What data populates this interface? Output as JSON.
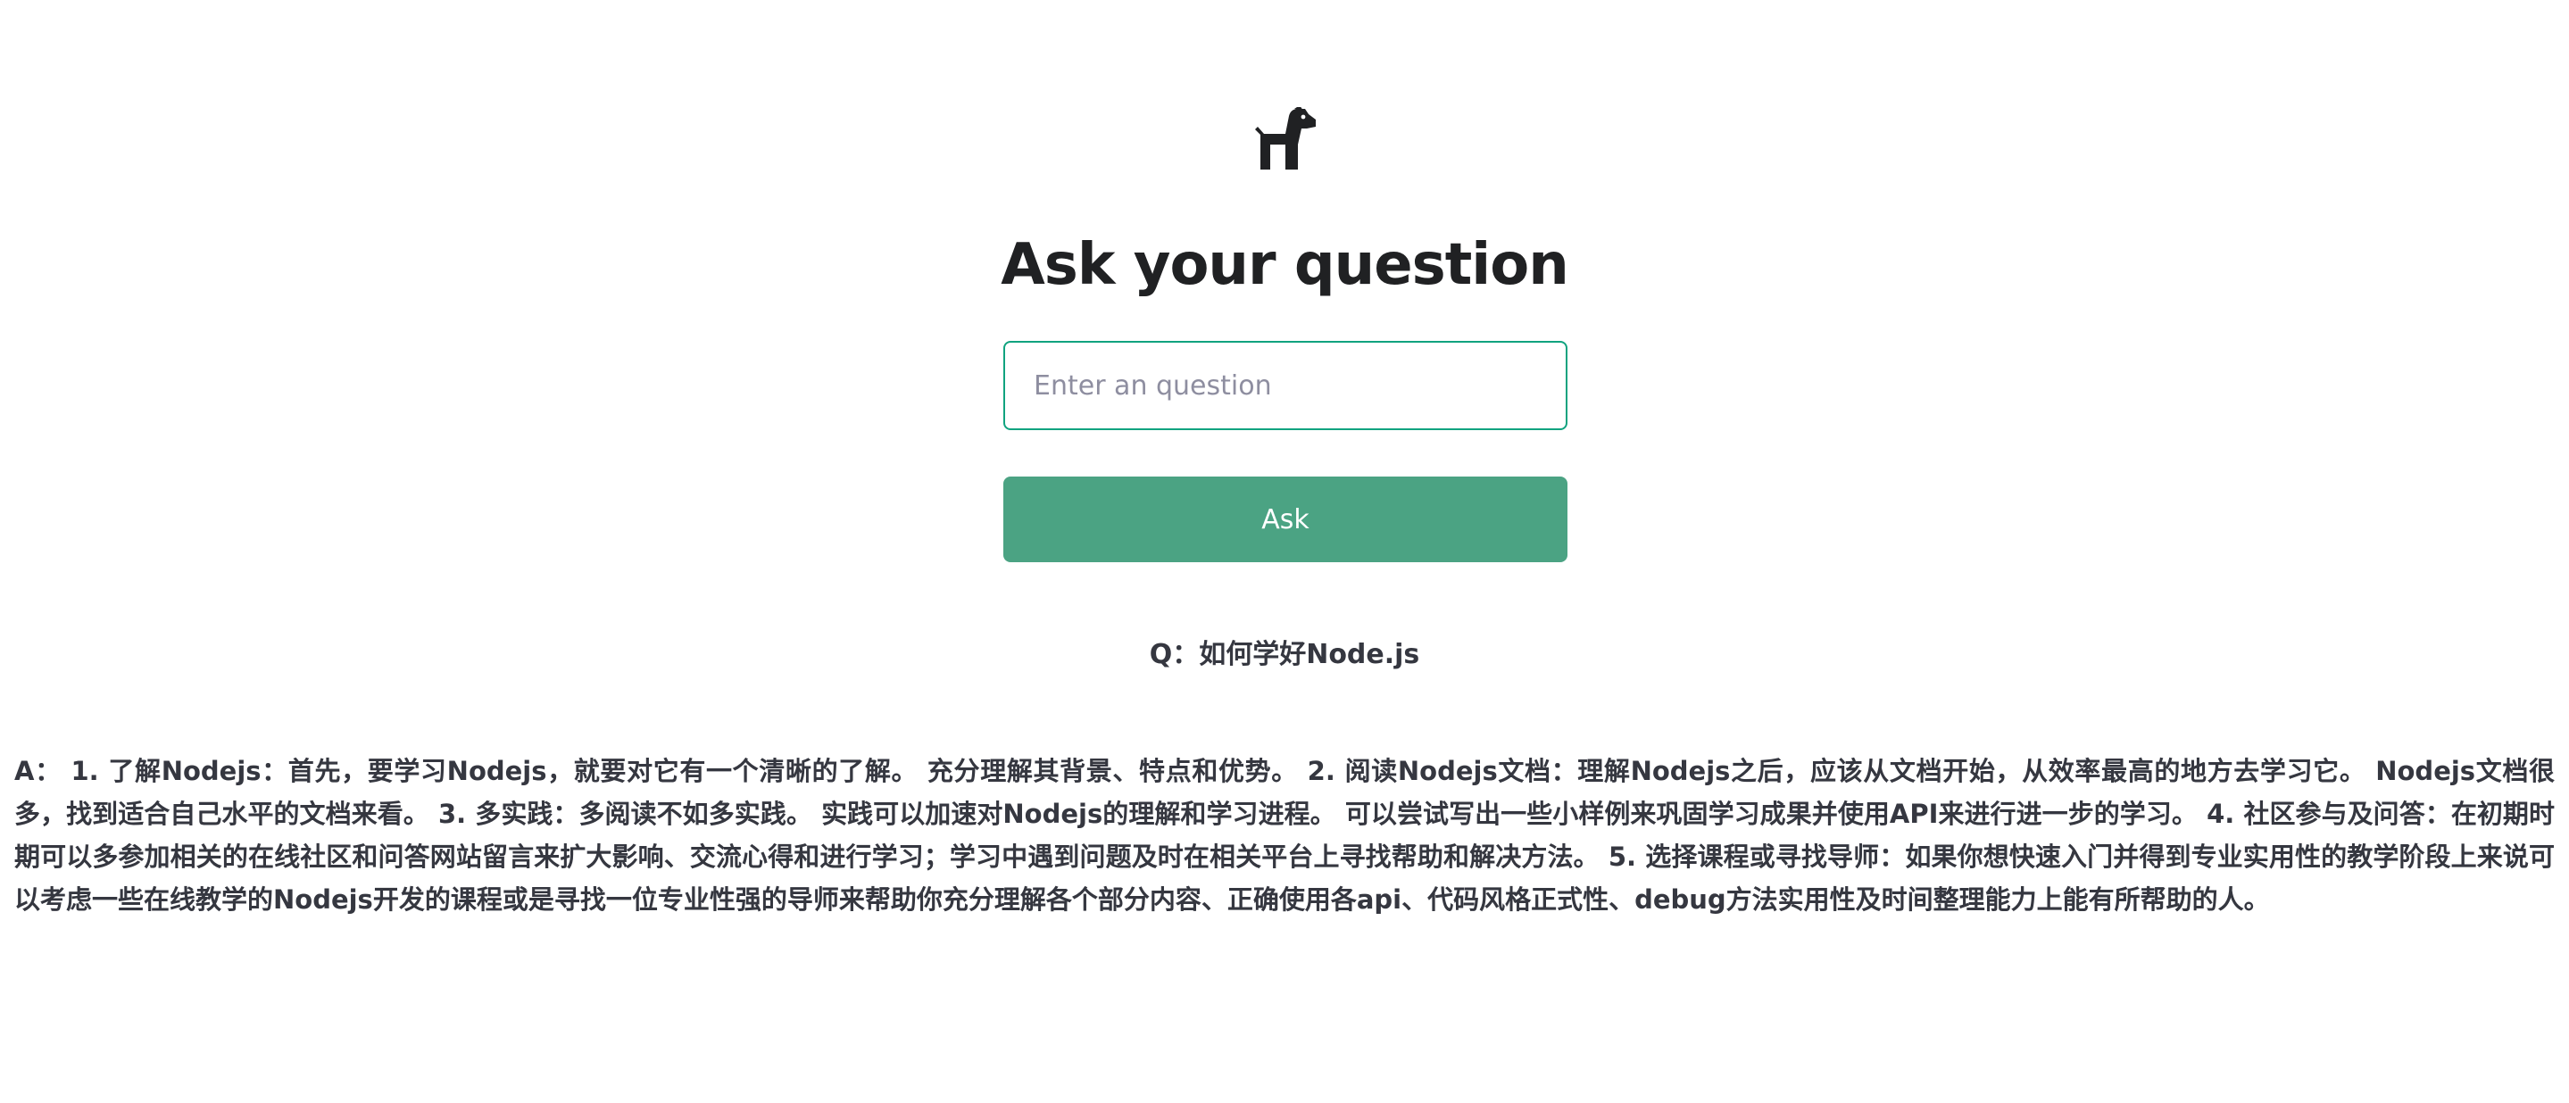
{
  "header": {
    "logo_icon": "dog-icon",
    "title": "Ask your question"
  },
  "form": {
    "input_value": "",
    "input_placeholder": "Enter an question",
    "ask_label": "Ask",
    "accent_color": "#10a37f",
    "button_color": "#4ba383"
  },
  "result": {
    "question": "Q：如何学好Node.js",
    "answer": "A： 1. 了解Nodejs：首先，要学习Nodejs，就要对它有一个清晰的了解。 充分理解其背景、特点和优势。 2. 阅读Nodejs文档：理解Nodejs之后，应该从文档开始，从效率最高的地方去学习它。 Nodejs文档很多，找到适合自己水平的文档来看。 3. 多实践：多阅读不如多实践。 实践可以加速对Nodejs的理解和学习进程。 可以尝试写出一些小样例来巩固学习成果并使用API来进行进一步的学习。 4. 社区参与及问答：在初期时期可以多参加相关的在线社区和问答网站留言来扩大影响、交流心得和进行学习；学习中遇到问题及时在相关平台上寻找帮助和解决方法。 5. 选择课程或寻找导师：如果你想快速入门并得到专业实用性的教学阶段上来说可以考虑一些在线教学的Nodejs开发的课程或是寻找一位专业性强的导师来帮助你充分理解各个部分内容、正确使用各api、代码风格正式性、debug方法实用性及时间整理能力上能有所帮助的人。"
  }
}
